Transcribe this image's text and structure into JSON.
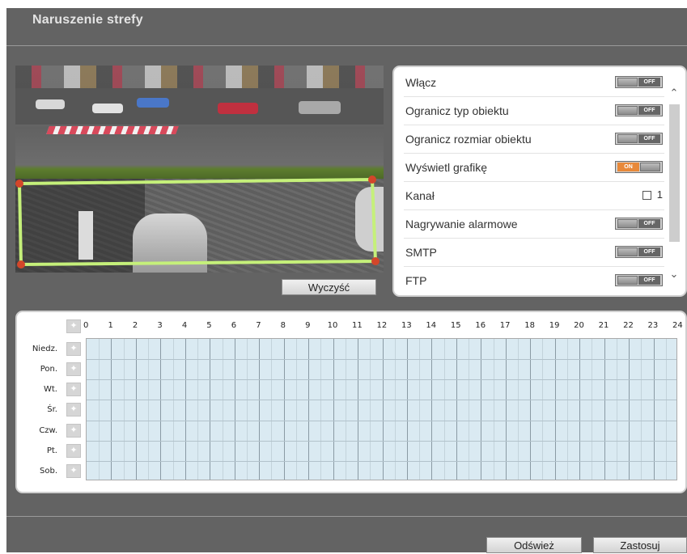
{
  "page": {
    "title": "Naruszenie strefy"
  },
  "preview": {
    "clear_label": "Wyczyść"
  },
  "settings": {
    "rows": [
      {
        "label": "Włącz",
        "control": "toggle",
        "state": "OFF"
      },
      {
        "label": "Ogranicz typ obiektu",
        "control": "toggle",
        "state": "OFF"
      },
      {
        "label": "Ogranicz rozmiar obiektu",
        "control": "toggle",
        "state": "OFF"
      },
      {
        "label": "Wyświetl grafikę",
        "control": "toggle",
        "state": "ON"
      },
      {
        "label": "Kanał",
        "control": "checkbox",
        "value": "1"
      },
      {
        "label": "Nagrywanie alarmowe",
        "control": "toggle",
        "state": "OFF"
      },
      {
        "label": "SMTP",
        "control": "toggle",
        "state": "OFF"
      },
      {
        "label": "FTP",
        "control": "toggle",
        "state": "OFF"
      }
    ],
    "scroll_up_icon": "chevron-up-icon",
    "scroll_down_icon": "chevron-down-icon"
  },
  "schedule": {
    "hours": [
      "0",
      "1",
      "2",
      "3",
      "4",
      "5",
      "6",
      "7",
      "8",
      "9",
      "10",
      "11",
      "12",
      "13",
      "14",
      "15",
      "16",
      "17",
      "18",
      "19",
      "20",
      "21",
      "22",
      "23",
      "24"
    ],
    "days": [
      "Niedz.",
      "Pon.",
      "Wt.",
      "Śr.",
      "Czw.",
      "Pt.",
      "Sob."
    ],
    "row_icon": "select-all-icon"
  },
  "footer": {
    "refresh_label": "Odśwież",
    "apply_label": "Zastosuj"
  },
  "colors": {
    "background": "#636363",
    "zone_outline": "#c5f07a",
    "zone_vertex": "#d3462a",
    "toggle_on": "#e8893a",
    "toggle_off": "#666666",
    "grid_fill": "#daeaf2"
  }
}
